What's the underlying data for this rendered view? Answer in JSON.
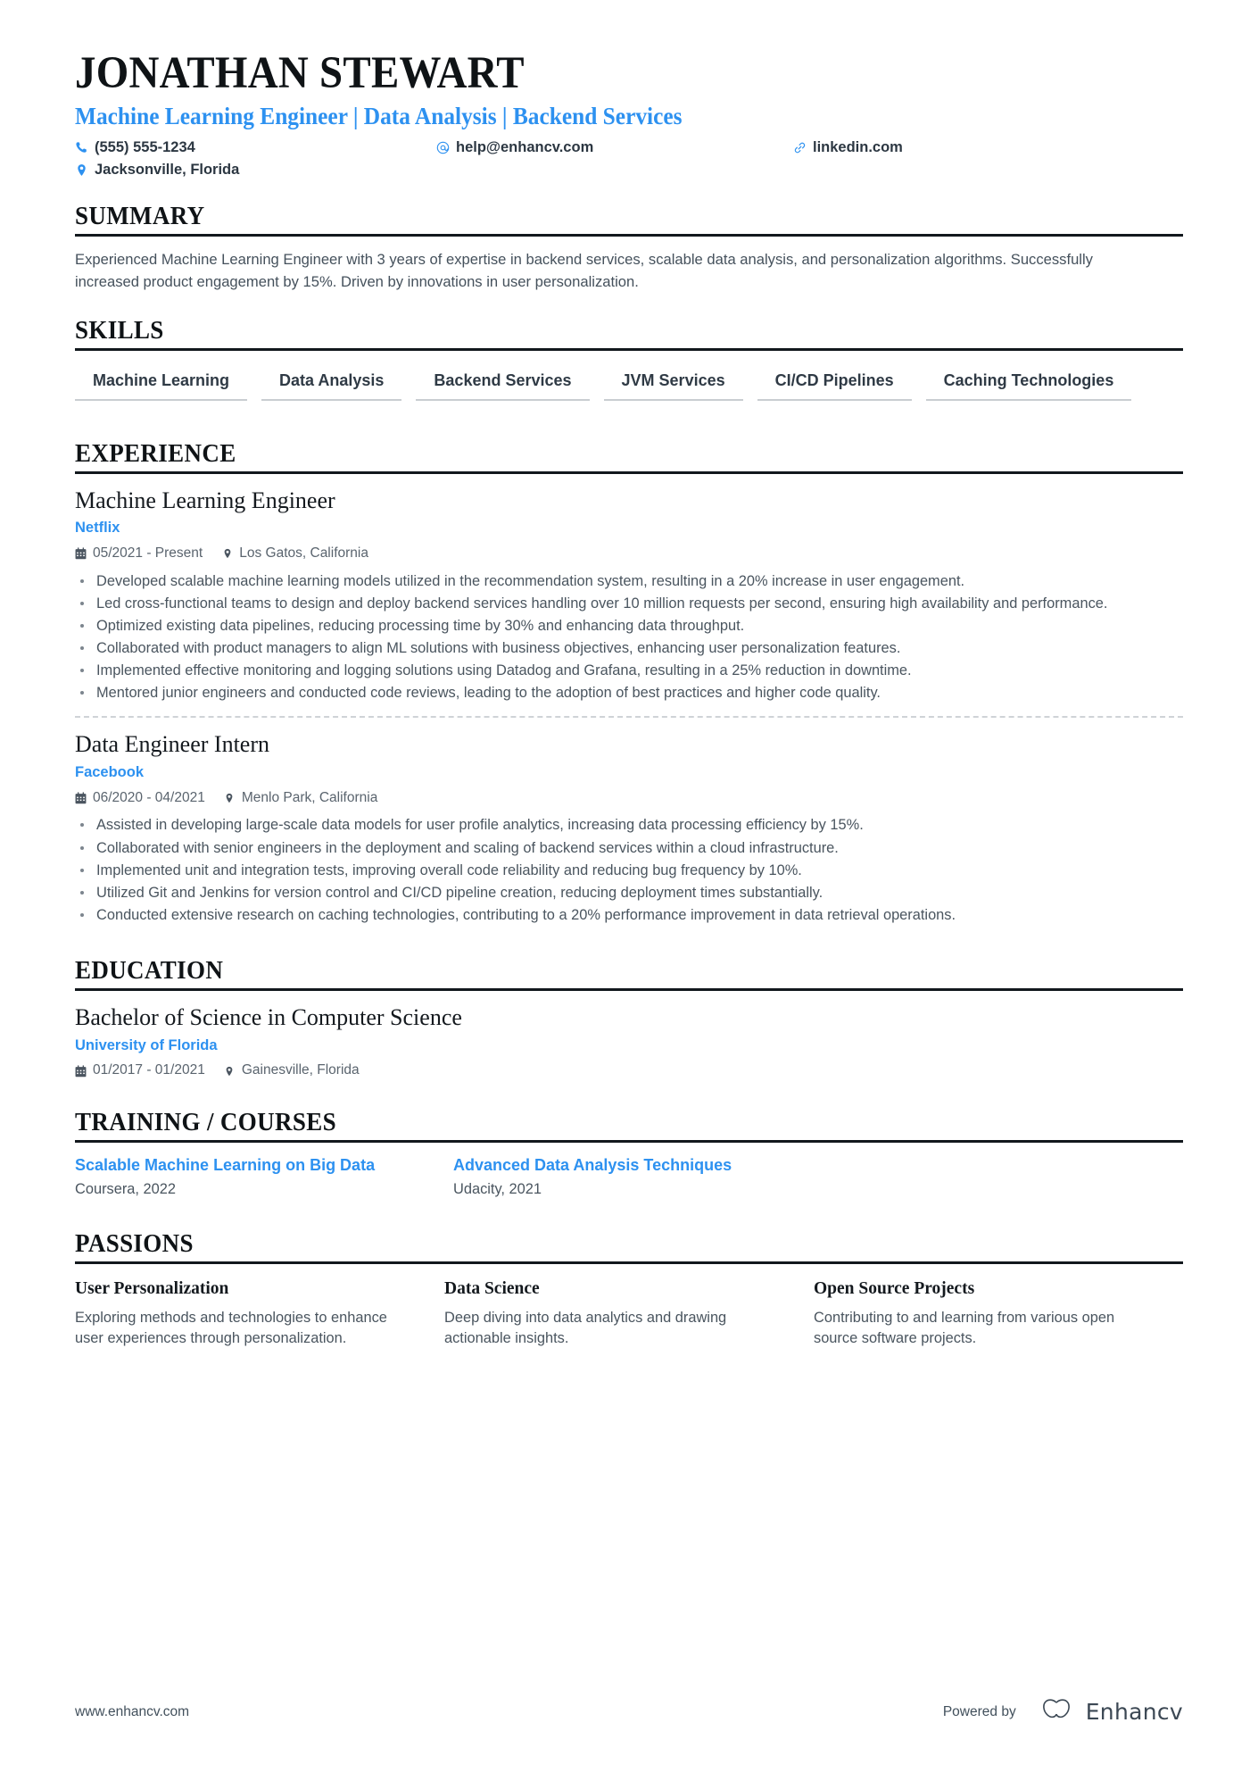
{
  "header": {
    "full_name": "JONATHAN STEWART",
    "headline": "Machine Learning Engineer | Data Analysis | Backend Services",
    "contacts": [
      {
        "icon": "phone-icon",
        "text": "(555) 555-1234"
      },
      {
        "icon": "email-icon",
        "text": "help@enhancv.com"
      },
      {
        "icon": "link-icon",
        "text": "linkedin.com"
      },
      {
        "icon": "location-icon",
        "text": "Jacksonville, Florida"
      }
    ]
  },
  "colors": {
    "accent_blue": "#2d91f0",
    "heading_black": "#0f1316",
    "body_gray": "#4a555f",
    "rule_black": "#12181d",
    "skill_underline": "#c9cdd1"
  },
  "summary": {
    "title": "SUMMARY",
    "text": "Experienced Machine Learning Engineer with 3 years of expertise in backend services, scalable data analysis, and personalization algorithms. Successfully increased product engagement by 15%. Driven by innovations in user personalization."
  },
  "skills": {
    "title": "SKILLS",
    "items": [
      "Machine Learning",
      "Data Analysis",
      "Backend Services",
      "JVM Services",
      "CI/CD Pipelines",
      "Caching Technologies"
    ]
  },
  "experience": {
    "title": "EXPERIENCE",
    "entries": [
      {
        "role": "Machine Learning Engineer",
        "company": "Netflix",
        "dates": "05/2021 - Present",
        "location": "Los Gatos, California",
        "bullets": [
          "Developed scalable machine learning models utilized in the recommendation system, resulting in a 20% increase in user engagement.",
          "Led cross-functional teams to design and deploy backend services handling over 10 million requests per second, ensuring high availability and performance.",
          "Optimized existing data pipelines, reducing processing time by 30% and enhancing data throughput.",
          "Collaborated with product managers to align ML solutions with business objectives, enhancing user personalization features.",
          "Implemented effective monitoring and logging solutions using Datadog and Grafana, resulting in a 25% reduction in downtime.",
          "Mentored junior engineers and conducted code reviews, leading to the adoption of best practices and higher code quality."
        ]
      },
      {
        "role": "Data Engineer Intern",
        "company": "Facebook",
        "dates": "06/2020 - 04/2021",
        "location": "Menlo Park, California",
        "bullets": [
          "Assisted in developing large-scale data models for user profile analytics, increasing data processing efficiency by 15%.",
          "Collaborated with senior engineers in the deployment and scaling of backend services within a cloud infrastructure.",
          "Implemented unit and integration tests, improving overall code reliability and reducing bug frequency by 10%.",
          "Utilized Git and Jenkins for version control and CI/CD pipeline creation, reducing deployment times substantially.",
          "Conducted extensive research on caching technologies, contributing to a 20% performance improvement in data retrieval operations."
        ]
      }
    ]
  },
  "education": {
    "title": "EDUCATION",
    "entries": [
      {
        "degree": "Bachelor of Science in Computer Science",
        "school": "University of Florida",
        "dates": "01/2017 - 01/2021",
        "location": "Gainesville, Florida"
      }
    ]
  },
  "training": {
    "title": "TRAINING / COURSES",
    "courses": [
      {
        "name": "Scalable Machine Learning on Big Data",
        "provider": "Coursera, 2022"
      },
      {
        "name": "Advanced Data Analysis Techniques",
        "provider": "Udacity, 2021"
      }
    ]
  },
  "passions": {
    "title": "PASSIONS",
    "items": [
      {
        "name": "User Personalization",
        "description": "Exploring methods and technologies to enhance user experiences through personalization."
      },
      {
        "name": "Data Science",
        "description": "Deep diving into data analytics and drawing actionable insights."
      },
      {
        "name": "Open Source Projects",
        "description": "Contributing to and learning from various open source software projects."
      }
    ]
  },
  "footer": {
    "url": "www.enhancv.com",
    "powered_by": "Powered by",
    "brand": "Enhancv"
  }
}
